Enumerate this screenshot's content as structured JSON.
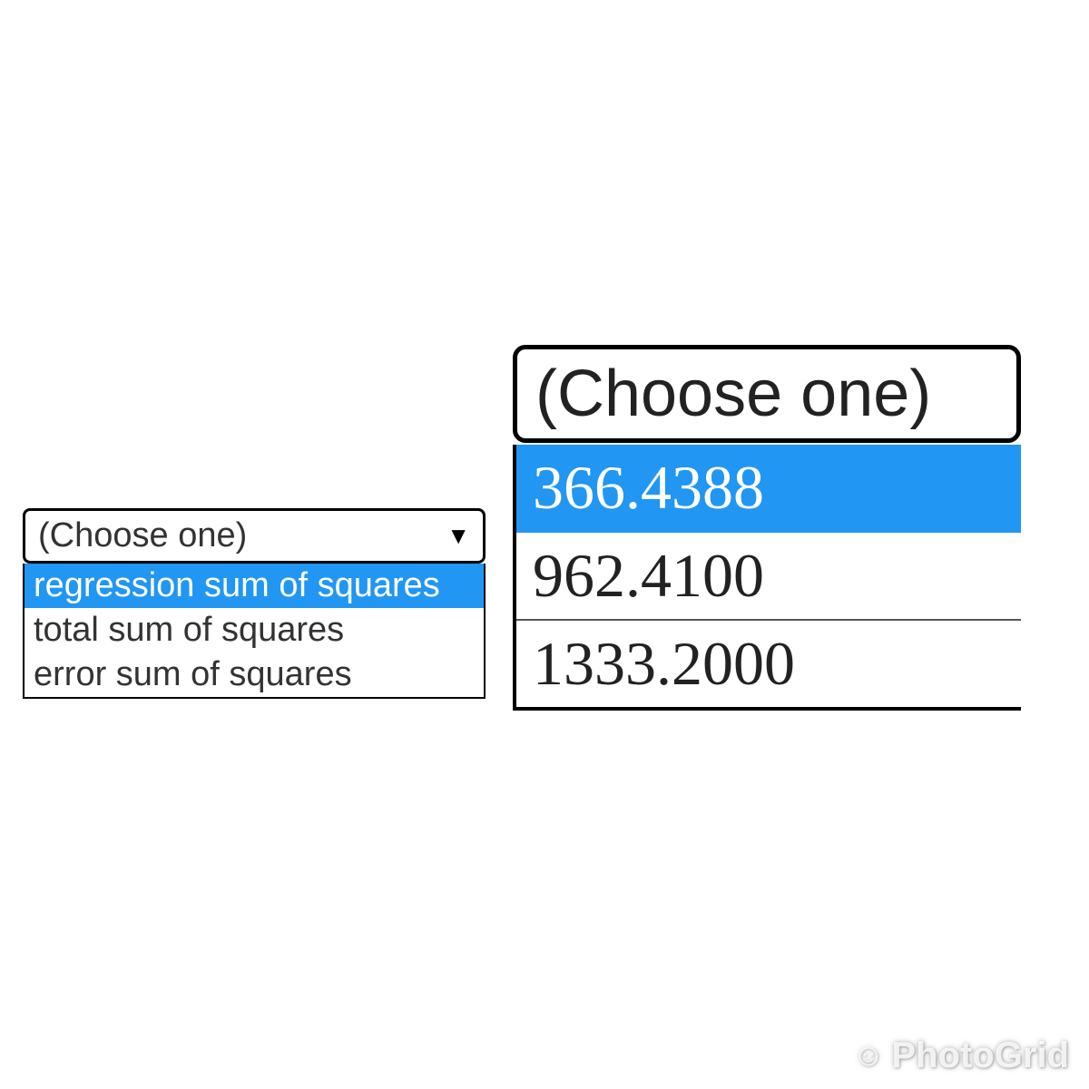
{
  "left_dropdown": {
    "placeholder": "(Choose one)",
    "options": [
      {
        "label": "regression sum of squares",
        "highlighted": true
      },
      {
        "label": "total sum of squares",
        "highlighted": false
      },
      {
        "label": "error sum of squares",
        "highlighted": false
      }
    ]
  },
  "right_dropdown": {
    "placeholder": "(Choose one)",
    "options": [
      {
        "label": "366.4388",
        "highlighted": true
      },
      {
        "label": "962.4100",
        "highlighted": false
      },
      {
        "label": "1333.2000",
        "highlighted": false
      }
    ]
  },
  "watermark": {
    "text": "PhotoGrid",
    "icon": "☺"
  },
  "colors": {
    "highlight_bg": "#2196f3",
    "highlight_fg": "#ffffff",
    "text": "#333333",
    "border": "#000000"
  }
}
